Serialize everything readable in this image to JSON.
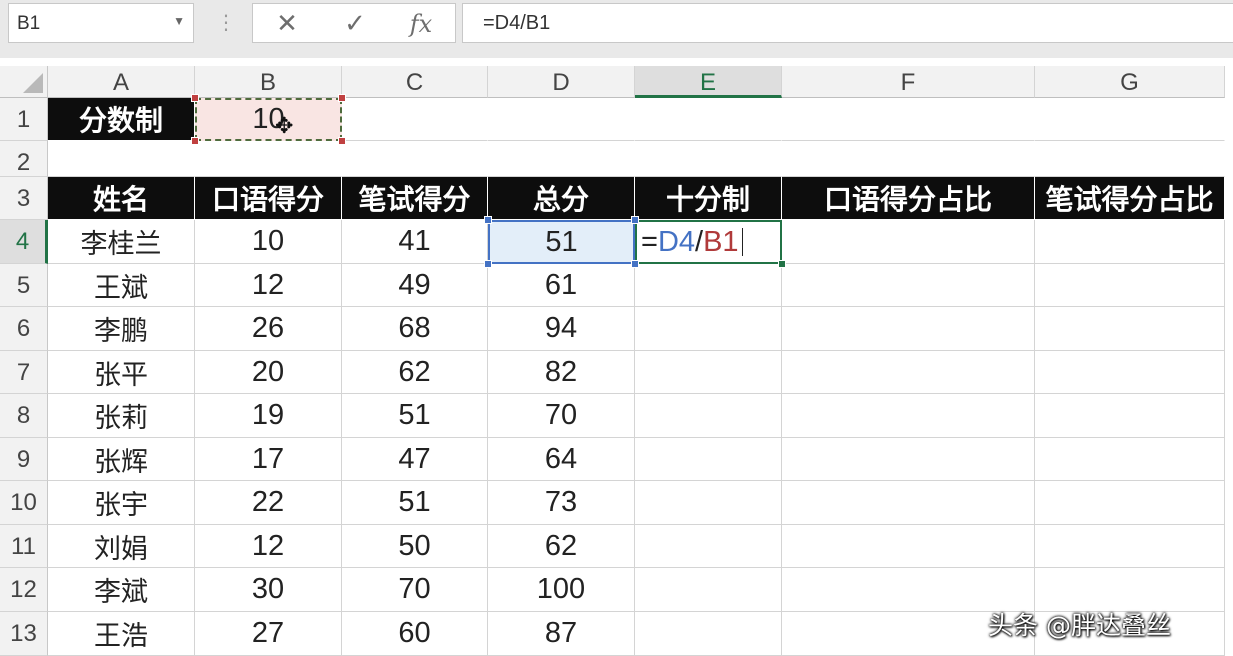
{
  "formula_bar": {
    "name_box": "B1",
    "fx_label": "fx",
    "formula": "=D4/B1"
  },
  "columns": [
    "A",
    "B",
    "C",
    "D",
    "E",
    "F",
    "G"
  ],
  "rows": [
    "1",
    "2",
    "3",
    "4",
    "5",
    "6",
    "7",
    "8",
    "9",
    "10",
    "11",
    "12",
    "13"
  ],
  "b1_label": "分数制",
  "b1_value": "10",
  "table": {
    "headers": [
      "姓名",
      "口语得分",
      "笔试得分",
      "总分",
      "十分制",
      "口语得分占比",
      "笔试得分占比"
    ],
    "rows": [
      {
        "name": "李桂兰",
        "oral": "10",
        "written": "41",
        "total": "51"
      },
      {
        "name": "王斌",
        "oral": "12",
        "written": "49",
        "total": "61"
      },
      {
        "name": "李鹏",
        "oral": "26",
        "written": "68",
        "total": "94"
      },
      {
        "name": "张平",
        "oral": "20",
        "written": "62",
        "total": "82"
      },
      {
        "name": "张莉",
        "oral": "19",
        "written": "51",
        "total": "70"
      },
      {
        "name": "张辉",
        "oral": "17",
        "written": "47",
        "total": "64"
      },
      {
        "name": "张宇",
        "oral": "22",
        "written": "51",
        "total": "73"
      },
      {
        "name": "刘娟",
        "oral": "12",
        "written": "50",
        "total": "62"
      },
      {
        "name": "李斌",
        "oral": "30",
        "written": "70",
        "total": "100"
      },
      {
        "name": "王浩",
        "oral": "27",
        "written": "60",
        "total": "87"
      }
    ]
  },
  "editing_cell": {
    "eq": "=",
    "ref1": "D4",
    "slash": "/",
    "ref2": "B1"
  },
  "watermark": "头条 @胖达叠丝"
}
